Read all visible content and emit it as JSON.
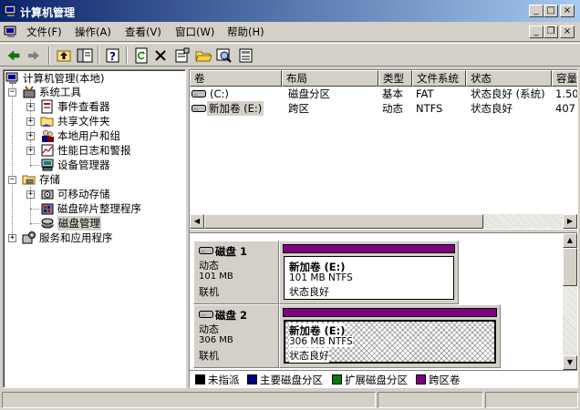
{
  "window": {
    "title": "计算机管理",
    "caption_buttons": {
      "minimize": "_",
      "maximize": "□",
      "close": "×"
    }
  },
  "menu": {
    "items": [
      {
        "label": "文件(F)",
        "key": "file"
      },
      {
        "label": "操作(A)",
        "key": "action"
      },
      {
        "label": "查看(V)",
        "key": "view"
      },
      {
        "label": "窗口(W)",
        "key": "window"
      },
      {
        "label": "帮助(H)",
        "key": "help"
      }
    ],
    "child_buttons": {
      "minimize": "_",
      "restore": "❐",
      "close": "×"
    }
  },
  "toolbar": {
    "icons": [
      "back-icon",
      "forward-icon",
      "up-icon",
      "show-hide-tree-icon",
      "properties-icon",
      "refresh-icon",
      "delete-icon",
      "properties-sheet-icon",
      "open-icon",
      "search-icon",
      "help-icon"
    ]
  },
  "tree": {
    "root": "计算机管理(本地)",
    "system_tools": "系统工具",
    "event_viewer": "事件查看器",
    "shared_folders": "共享文件夹",
    "local_users": "本地用户和组",
    "perf_logs": "性能日志和警报",
    "device_manager": "设备管理器",
    "storage": "存储",
    "removable_storage": "可移动存储",
    "defrag": "磁盘碎片整理程序",
    "disk_management": "磁盘管理",
    "services_apps": "服务和应用程序"
  },
  "volume_list": {
    "columns": [
      "卷",
      "布局",
      "类型",
      "文件系统",
      "状态",
      "容量"
    ],
    "rows": [
      {
        "volume": "(C:)",
        "layout": "磁盘分区",
        "type": "基本",
        "fs": "FAT",
        "status": "状态良好 (系统)",
        "capacity": "1.50"
      },
      {
        "volume": "新加卷 (E:)",
        "layout": "跨区",
        "type": "动态",
        "fs": "NTFS",
        "status": "状态良好",
        "capacity": "407"
      }
    ]
  },
  "disks": [
    {
      "name": "磁盘 1",
      "type": "动态",
      "size": "101 MB",
      "state": "联机",
      "volume": {
        "name": "新加卷  (E:)",
        "size_fs": "101 MB NTFS",
        "status": "状态良好"
      }
    },
    {
      "name": "磁盘 2",
      "type": "动态",
      "size": "306 MB",
      "state": "联机",
      "volume": {
        "name": "新加卷  (E:)",
        "size_fs": "306 MB NTFS",
        "status": "状态良好"
      }
    }
  ],
  "legend": [
    {
      "label": "未指派",
      "color": "#000000"
    },
    {
      "label": "主要磁盘分区",
      "color": "#000080"
    },
    {
      "label": "扩展磁盘分区",
      "color": "#008000"
    },
    {
      "label": "跨区卷",
      "color": "#800080"
    }
  ],
  "colors": {
    "titlebar_start": "#0a246a",
    "titlebar_end": "#a6caf0",
    "spanned_volume": "#800080"
  }
}
